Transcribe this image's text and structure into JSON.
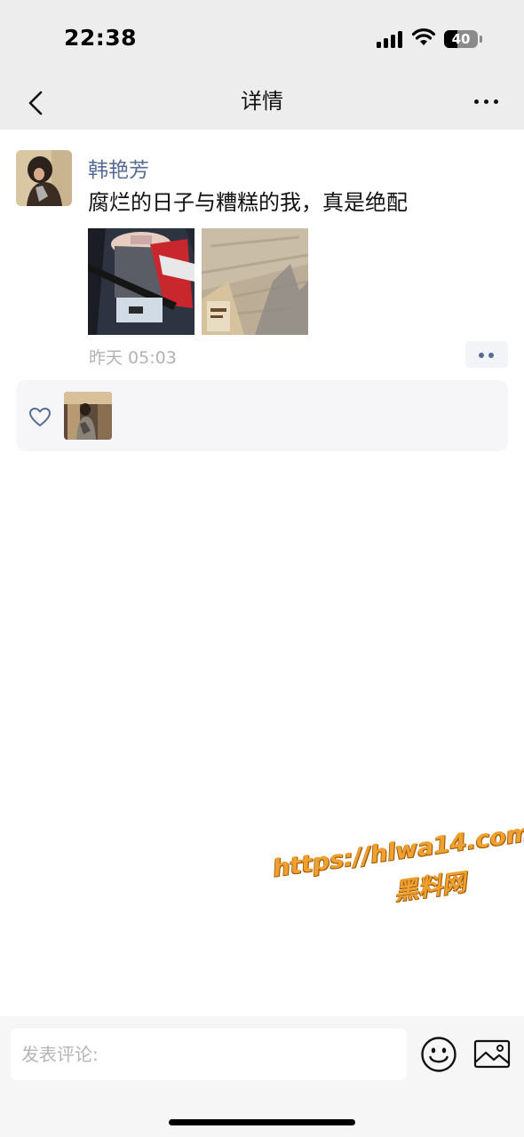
{
  "status_bar": {
    "time": "22:38",
    "battery_text": "40",
    "battery_level": 0.4
  },
  "nav": {
    "title": "详情",
    "back_icon": "chevron-left-icon",
    "more_icon": "more-dots-icon"
  },
  "post": {
    "author": "韩艳芳",
    "text": "腐烂的日子与糟糕的我，真是绝配",
    "photo_count": 2,
    "time": "昨天 05:03",
    "action_icon": "two-dots-icon"
  },
  "likes": {
    "icon": "heart-outline-icon",
    "count_shown": 1
  },
  "watermark": {
    "url": "https://hlwa14.com",
    "name": "黑料网"
  },
  "comment_bar": {
    "placeholder": "发表评论:",
    "emoji_icon": "smiley-icon",
    "image_icon": "image-icon"
  },
  "colors": {
    "bar_bg": "#ededed",
    "link_blue": "#576b95",
    "meta_gray": "#b2b2b2",
    "likes_bg": "#f6f6f8"
  }
}
